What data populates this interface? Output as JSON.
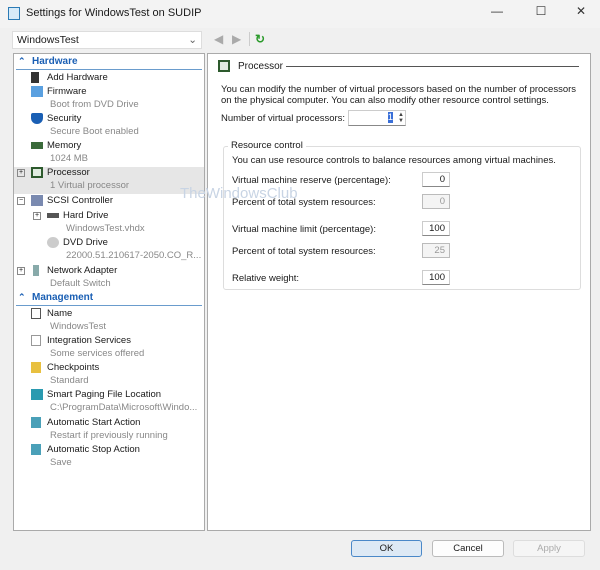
{
  "window": {
    "title": "Settings for WindowsTest on SUDIP",
    "minimize": "—",
    "maximize": "☐",
    "close": "✕"
  },
  "vm_selector": {
    "value": "WindowsTest"
  },
  "nav": {
    "back": "◀",
    "forward": "▶",
    "refresh": "↻"
  },
  "tree": {
    "hardware_label": "Hardware",
    "management_label": "Management",
    "hardware": [
      {
        "label": "Add Hardware",
        "sub": ""
      },
      {
        "label": "Firmware",
        "sub": "Boot from DVD Drive"
      },
      {
        "label": "Security",
        "sub": "Secure Boot enabled"
      },
      {
        "label": "Memory",
        "sub": "1024 MB"
      },
      {
        "label": "Processor",
        "sub": "1 Virtual processor"
      },
      {
        "label": "SCSI Controller",
        "sub": ""
      },
      {
        "label": "Hard Drive",
        "sub": "WindowsTest.vhdx"
      },
      {
        "label": "DVD Drive",
        "sub": "22000.51.210617-2050.CO_R..."
      },
      {
        "label": "Network Adapter",
        "sub": "Default Switch"
      }
    ],
    "management": [
      {
        "label": "Name",
        "sub": "WindowsTest"
      },
      {
        "label": "Integration Services",
        "sub": "Some services offered"
      },
      {
        "label": "Checkpoints",
        "sub": "Standard"
      },
      {
        "label": "Smart Paging File Location",
        "sub": "C:\\ProgramData\\Microsoft\\Windo..."
      },
      {
        "label": "Automatic Start Action",
        "sub": "Restart if previously running"
      },
      {
        "label": "Automatic Stop Action",
        "sub": "Save"
      }
    ]
  },
  "processor": {
    "heading": "Processor",
    "description": "You can modify the number of virtual processors based on the number of processors on the physical computer. You can also modify other resource control settings.",
    "num_label": "Number of virtual processors:",
    "num_value": "1",
    "resource": {
      "title": "Resource control",
      "description": "You can use resource controls to balance resources among virtual machines.",
      "reserve_label": "Virtual machine reserve (percentage):",
      "reserve_value": "0",
      "reserve_pct_label": "Percent of total system resources:",
      "reserve_pct_value": "0",
      "limit_label": "Virtual machine limit (percentage):",
      "limit_value": "100",
      "limit_pct_label": "Percent of total system resources:",
      "limit_pct_value": "25",
      "weight_label": "Relative weight:",
      "weight_value": "100"
    }
  },
  "watermark": "TheWindowsClub",
  "buttons": {
    "ok": "OK",
    "cancel": "Cancel",
    "apply": "Apply"
  }
}
